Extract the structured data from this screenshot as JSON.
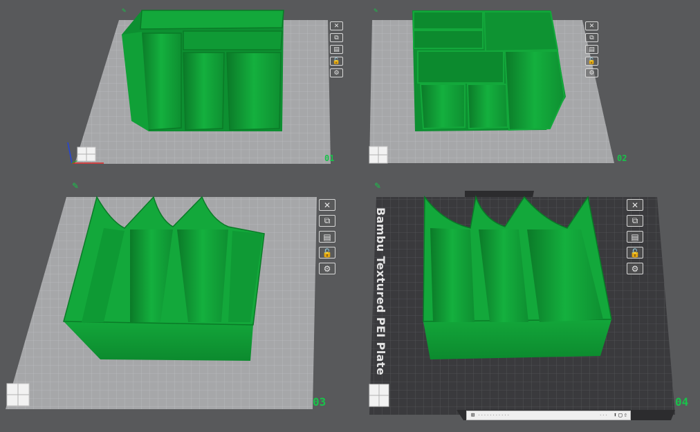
{
  "plates": [
    {
      "number": "01"
    },
    {
      "number": "02"
    },
    {
      "number": "03"
    },
    {
      "number": "04",
      "label": "Bambu Textured PEI Plate"
    }
  ],
  "plate_tools": [
    {
      "icon": "close-icon",
      "glyph": "✕"
    },
    {
      "icon": "arrange-icon",
      "glyph": "⧉"
    },
    {
      "icon": "orient-icon",
      "glyph": "▤"
    },
    {
      "icon": "lock-icon",
      "glyph": "🔓"
    },
    {
      "icon": "settings-icon",
      "glyph": "⚙"
    }
  ],
  "status_bar": {
    "left_text": "···········",
    "mid_text": "···"
  },
  "colors": {
    "background": "#58595b",
    "model_green": "#12a337",
    "plate_light": "#a8a9ab",
    "plate_dark": "#3a3a3d",
    "accent": "#19c24a"
  }
}
